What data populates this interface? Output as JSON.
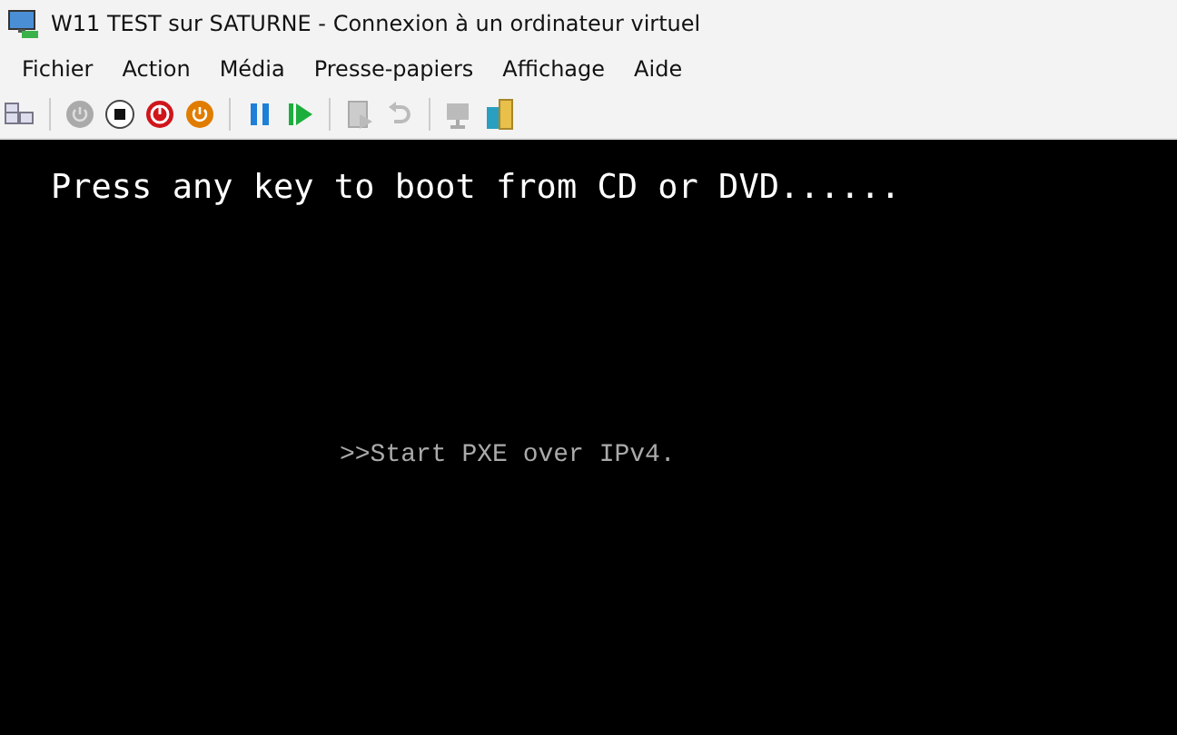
{
  "window": {
    "title": "W11 TEST sur SATURNE - Connexion à un ordinateur virtuel"
  },
  "menu": [
    "Fichier",
    "Action",
    "Média",
    "Presse-papiers",
    "Affichage",
    "Aide"
  ],
  "toolbar": [
    {
      "kind": "ctrl-alt-del"
    },
    {
      "kind": "separator"
    },
    {
      "kind": "start"
    },
    {
      "kind": "turn-off"
    },
    {
      "kind": "shutdown"
    },
    {
      "kind": "save"
    },
    {
      "kind": "separator"
    },
    {
      "kind": "pause"
    },
    {
      "kind": "reset"
    },
    {
      "kind": "separator"
    },
    {
      "kind": "checkpoint"
    },
    {
      "kind": "revert"
    },
    {
      "kind": "separator"
    },
    {
      "kind": "enhanced-session"
    },
    {
      "kind": "share"
    }
  ],
  "console": {
    "boot_prompt": "Press any key to boot from CD or DVD......",
    "pxe_message": ">>Start PXE over IPv4."
  }
}
